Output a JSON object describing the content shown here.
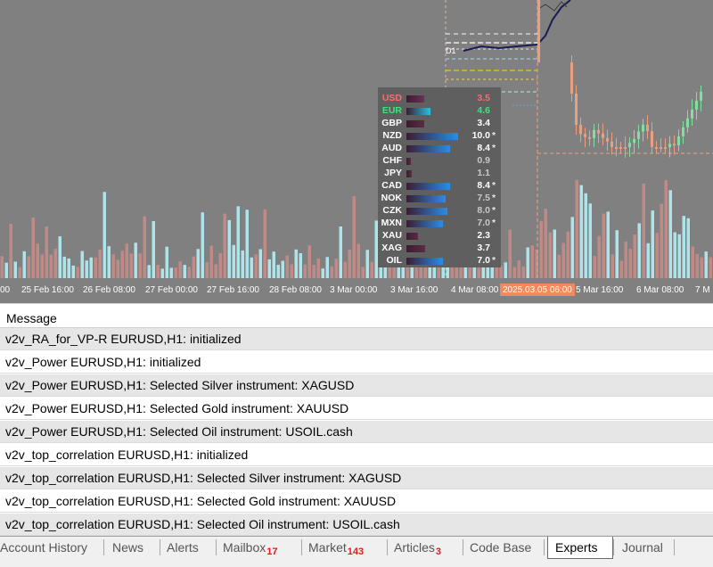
{
  "chart": {
    "timeframe_label": "D1",
    "time_axis": [
      "25 Feb 16:00",
      "26 Feb 08:00",
      "27 Feb 00:00",
      "27 Feb 16:00",
      "28 Feb 08:00",
      "3 Mar 00:00",
      "3 Mar 16:00",
      "4 Mar 08:00",
      "2025.03.05 06:00",
      "5 Mar 16:00",
      "6 Mar 08:00",
      "7 M"
    ],
    "time_axis_first": "00",
    "colors": {
      "background": "#808080",
      "bull_volume": "#aee3ea",
      "bear_volume": "#c08a86",
      "bull_candle": "#7fe0a0",
      "bear_candle": "#e8a080",
      "crosshair": "#f3a07f",
      "highlight": "#f08a5d"
    }
  },
  "strength_panel": {
    "rows": [
      {
        "currency": "USD",
        "value": "3.5",
        "star": "",
        "color": "#ff6b6b",
        "value_color": "#ff6b6b",
        "bar_color": "#6a3050",
        "bar_fraction": 0.35
      },
      {
        "currency": "EUR",
        "value": "4.6",
        "star": "",
        "color": "#39e67a",
        "value_color": "#39e67a",
        "bar_color": "#25c3e0",
        "bar_fraction": 0.46
      },
      {
        "currency": "GBP",
        "value": "3.4",
        "star": "",
        "color": "#ffffff",
        "value_color": "#ffffff",
        "bar_color": "#5a2c44",
        "bar_fraction": 0.34
      },
      {
        "currency": "NZD",
        "value": "10.0",
        "star": "*",
        "color": "#ffffff",
        "value_color": "#ffffff",
        "bar_color": "#2a8de8",
        "bar_fraction": 1.0
      },
      {
        "currency": "AUD",
        "value": "8.4",
        "star": "*",
        "color": "#ffffff",
        "value_color": "#ffffff",
        "bar_color": "#2a8de8",
        "bar_fraction": 0.84
      },
      {
        "currency": "CHF",
        "value": "0.9",
        "star": "",
        "color": "#ffffff",
        "value_color": "#c8c8c8",
        "bar_color": "#5a2c44",
        "bar_fraction": 0.09
      },
      {
        "currency": "JPY",
        "value": "1.1",
        "star": "",
        "color": "#ffffff",
        "value_color": "#c8c8c8",
        "bar_color": "#5a2c44",
        "bar_fraction": 0.11
      },
      {
        "currency": "CAD",
        "value": "8.4",
        "star": "*",
        "color": "#ffffff",
        "value_color": "#ffffff",
        "bar_color": "#2a8de8",
        "bar_fraction": 0.84
      },
      {
        "currency": "NOK",
        "value": "7.5",
        "star": "*",
        "color": "#ffffff",
        "value_color": "#c8c8c8",
        "bar_color": "#2a8de8",
        "bar_fraction": 0.75
      },
      {
        "currency": "CZK",
        "value": "8.0",
        "star": "*",
        "color": "#ffffff",
        "value_color": "#c8c8c8",
        "bar_color": "#2a8de8",
        "bar_fraction": 0.8
      },
      {
        "currency": "MXN",
        "value": "7.0",
        "star": "*",
        "color": "#ffffff",
        "value_color": "#c8c8c8",
        "bar_color": "#2a8de8",
        "bar_fraction": 0.7
      },
      {
        "currency": "XAU",
        "value": "2.3",
        "star": "",
        "color": "#ffffff",
        "value_color": "#ffffff",
        "bar_color": "#5a2c44",
        "bar_fraction": 0.23
      },
      {
        "currency": "XAG",
        "value": "3.7",
        "star": "",
        "color": "#ffffff",
        "value_color": "#ffffff",
        "bar_color": "#5a2c44",
        "bar_fraction": 0.37
      },
      {
        "currency": "OIL",
        "value": "7.0",
        "star": "*",
        "color": "#ffffff",
        "value_color": "#ffffff",
        "bar_color": "#2a8de8",
        "bar_fraction": 0.7
      }
    ]
  },
  "messages": {
    "header": "Message",
    "rows": [
      "v2v_RA_for_VP-R EURUSD,H1: initialized",
      "v2v_Power EURUSD,H1: initialized",
      "v2v_Power EURUSD,H1: Selected Silver instrument: XAGUSD",
      "v2v_Power EURUSD,H1: Selected Gold instrument: XAUUSD",
      "v2v_Power EURUSD,H1: Selected Oil instrument: USOIL.cash",
      "v2v_top_correlation EURUSD,H1: initialized",
      "v2v_top_correlation EURUSD,H1: Selected Silver instrument: XAGUSD",
      "v2v_top_correlation EURUSD,H1: Selected Gold instrument: XAUUSD",
      "v2v_top_correlation EURUSD,H1: Selected Oil instrument: USOIL.cash"
    ]
  },
  "tabs": [
    {
      "label": "Account History",
      "badge": "",
      "active": false
    },
    {
      "label": "News",
      "badge": "",
      "active": false
    },
    {
      "label": "Alerts",
      "badge": "",
      "active": false
    },
    {
      "label": "Mailbox",
      "badge": "17",
      "active": false
    },
    {
      "label": "Market",
      "badge": "143",
      "active": false
    },
    {
      "label": "Articles",
      "badge": "3",
      "active": false
    },
    {
      "label": "Code Base",
      "badge": "",
      "active": false
    },
    {
      "label": "Experts",
      "badge": "",
      "active": true
    },
    {
      "label": "Journal",
      "badge": "",
      "active": false
    }
  ]
}
